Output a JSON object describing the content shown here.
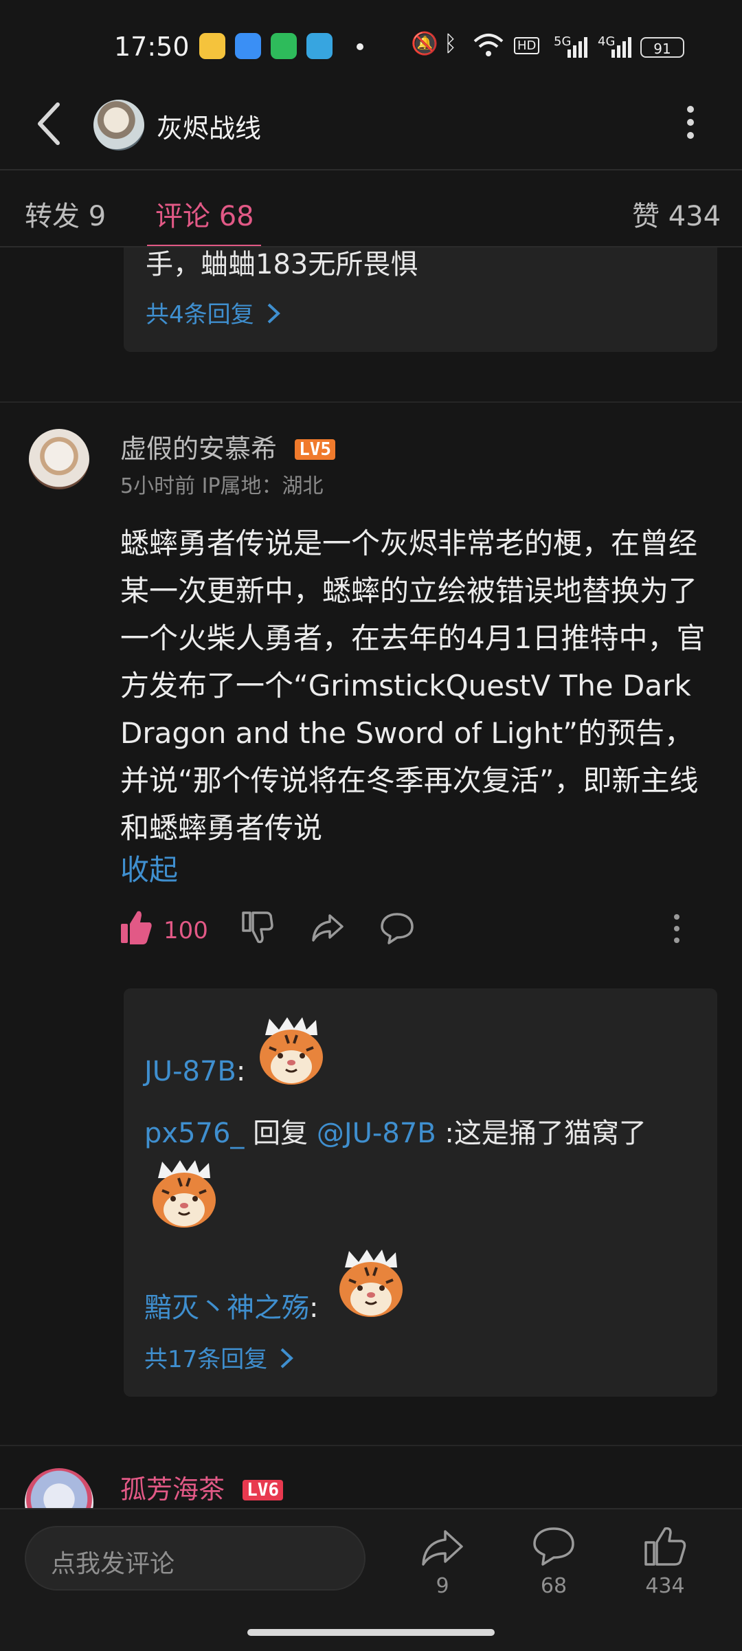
{
  "status_bar": {
    "time": "17:50",
    "network_labels": [
      "HD",
      "5G",
      "4G"
    ],
    "battery": "91"
  },
  "nav": {
    "title": "灰烬战线",
    "back_icon": "chevron-left-icon",
    "menu_icon": "more-vertical-icon"
  },
  "tabs": {
    "repost": "转发 9",
    "comments": "评论 68",
    "likes": "赞 434"
  },
  "prev_reply": {
    "text_tail": "手，蛐蛐183无所畏惧",
    "more": "共4条回复"
  },
  "comment": {
    "author": "虚假的安慕希",
    "level": "LV5",
    "meta": "5小时前  IP属地：湖北",
    "body": "蟋蟀勇者传说是一个灰烬非常老的梗，在曾经某一次更新中，蟋蟀的立绘被错误地替换为了一个火柴人勇者，在去年的4月1日推特中，官方发布了一个“GrimstickQuestV The Dark Dragon and the Sword of Light”的预告，并说“那个传说将在冬季再次复活”，即新主线和蟋蟀勇者传说",
    "collapse": "收起",
    "like_count": "100",
    "accent_color": "#e25986"
  },
  "sub_replies": {
    "r1_user": "JU-87B",
    "r1_sep": ":",
    "r2_user": "px576_",
    "r2_mid": " 回复 ",
    "r2_mention": "@JU-87B",
    "r2_text": " :这是捅了猫窝了",
    "r3_user": "黯灭丶神之殇",
    "r3_sep": ":",
    "more": "共17条回复"
  },
  "next_comment": {
    "author": "孤芳海茶",
    "level": "LV6"
  },
  "bottom_bar": {
    "input_placeholder": "点我发评论",
    "share_count": "9",
    "comment_count": "68",
    "like_count": "434"
  },
  "colors": {
    "background": "#161616",
    "link": "#3f8fcf",
    "accent": "#e25986",
    "level_badge": "#f07a2c"
  }
}
